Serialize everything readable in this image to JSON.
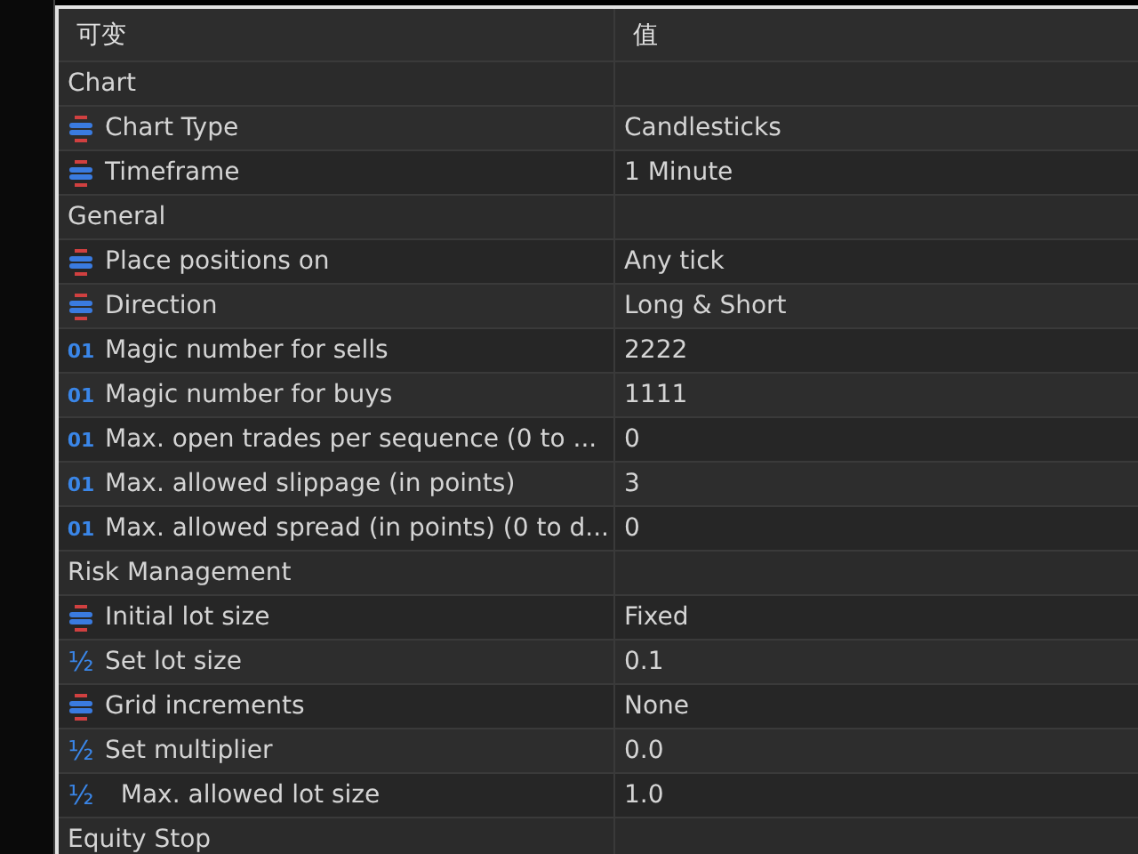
{
  "table": {
    "columns": [
      "可变",
      "值"
    ],
    "rows": [
      {
        "kind": "group",
        "name": "Chart"
      },
      {
        "kind": "enum",
        "name": "Chart Type",
        "value": "Candlesticks"
      },
      {
        "kind": "enum",
        "name": "Timeframe",
        "value": "1 Minute"
      },
      {
        "kind": "group",
        "name": "General"
      },
      {
        "kind": "enum",
        "name": "Place positions on",
        "value": "Any tick"
      },
      {
        "kind": "enum",
        "name": "Direction",
        "value": "Long & Short"
      },
      {
        "kind": "int",
        "icon": "01",
        "name": "Magic number for sells",
        "value": "2222"
      },
      {
        "kind": "int",
        "icon": "01",
        "name": "Magic number for buys",
        "value": "1111"
      },
      {
        "kind": "int",
        "icon": "01",
        "name": "Max. open trades per sequence (0 to ...",
        "value": "0"
      },
      {
        "kind": "int",
        "icon": "01",
        "name": "Max. allowed slippage (in points)",
        "value": "3"
      },
      {
        "kind": "int",
        "icon": "01",
        "name": "Max. allowed spread (in points) (0 to d...",
        "value": "0"
      },
      {
        "kind": "group",
        "name": "Risk Management"
      },
      {
        "kind": "enum",
        "name": "Initial lot size",
        "value": "Fixed"
      },
      {
        "kind": "double",
        "icon": "½",
        "name": "Set lot size",
        "value": "0.1"
      },
      {
        "kind": "enum",
        "name": "Grid increments",
        "value": "None"
      },
      {
        "kind": "double",
        "icon": "½",
        "name": "Set multiplier",
        "value": "0.0"
      },
      {
        "kind": "double",
        "icon": "½",
        "name": "  Max. allowed lot size",
        "value": "1.0"
      },
      {
        "kind": "group",
        "name": "Equity Stop"
      }
    ]
  }
}
